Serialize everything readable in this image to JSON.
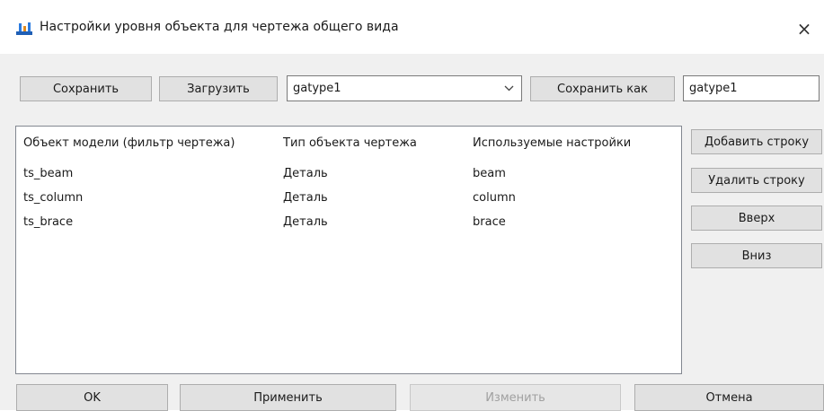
{
  "window": {
    "title": "Настройки уровня объекта для чертежа общего вида",
    "close_label": "×"
  },
  "toolbar": {
    "save_label": "Сохранить",
    "load_label": "Загрузить",
    "preset_select_value": "gatype1",
    "save_as_label": "Сохранить как",
    "save_as_name_value": "gatype1"
  },
  "table": {
    "columns": [
      "Объект модели (фильтр чертежа)",
      "Тип объекта чертежа",
      "Используемые настройки"
    ],
    "rows": [
      [
        "ts_beam",
        "Деталь",
        "beam"
      ],
      [
        "ts_column",
        "Деталь",
        "column"
      ],
      [
        "ts_brace",
        "Деталь",
        "brace"
      ]
    ]
  },
  "side_buttons": {
    "add_row": "Добавить строку",
    "delete_row": "Удалить строку",
    "up": "Вверх",
    "down": "Вниз"
  },
  "footer": {
    "ok": "OK",
    "apply": "Применить",
    "modify": "Изменить",
    "cancel": "Отмена"
  },
  "icons": {
    "app_icon": "tekla-settings-icon",
    "dropdown": "chevron-down-icon",
    "close": "close-icon"
  }
}
